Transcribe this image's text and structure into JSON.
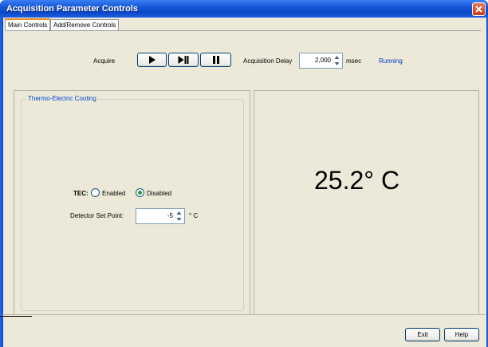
{
  "window": {
    "title": "Acquisition Parameter Controls"
  },
  "tabs": [
    {
      "label": "Main Controls",
      "active": true
    },
    {
      "label": "Add/Remove Controls",
      "active": false
    }
  ],
  "acquire": {
    "label": "Acquire",
    "buttons": [
      "play-icon",
      "step-icon",
      "pause-icon"
    ],
    "delay_label": "Acquisition Delay",
    "delay_value": "2,000",
    "delay_unit": "msec",
    "status": "Running",
    "status_color": "#0033cc"
  },
  "tec": {
    "group_title": "Thermo-Electric Cooling",
    "tec_label": "TEC:",
    "enabled_label": "Enabled",
    "disabled_label": "Disabled",
    "selected": "Disabled",
    "setpoint_label": "Detector Set Point:",
    "setpoint_value": "-5",
    "setpoint_unit": "° C"
  },
  "readout": {
    "temperature": "25.2° C"
  },
  "footer": {
    "exit_label": "Exit",
    "help_label": "Help"
  }
}
